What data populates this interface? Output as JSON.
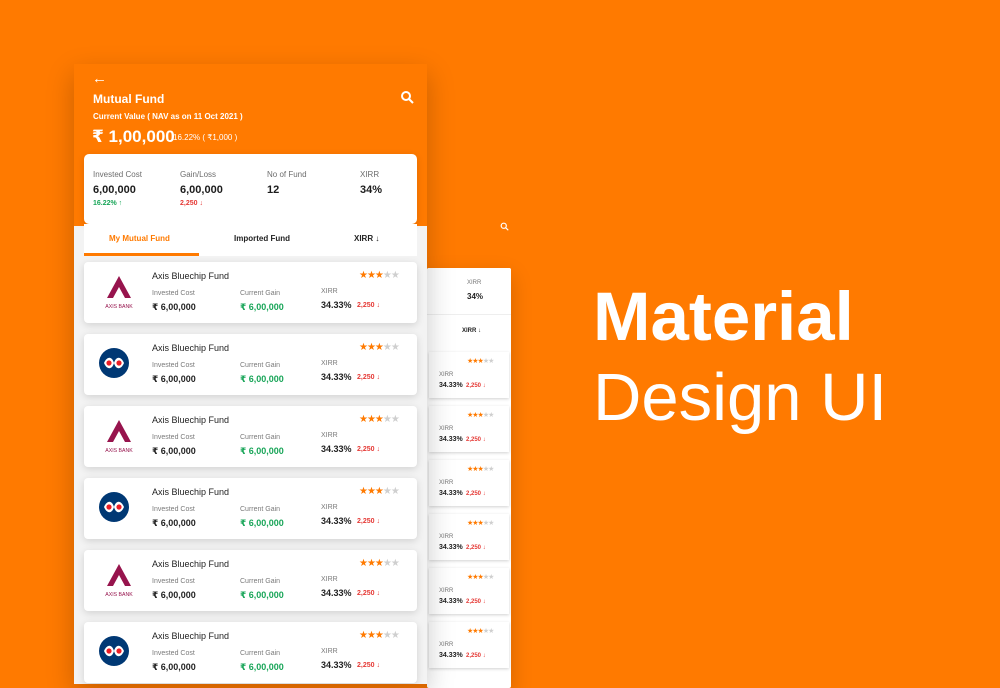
{
  "app": {
    "title": "Mutual Fund",
    "back_icon": "arrow-left-icon",
    "search_icon": "search-icon",
    "subtitle": "Current Value ( NAV as on 11 Oct 2021 )",
    "current_value": "₹ 1,00,000",
    "current_change": "16.22% ( ₹1,000 )"
  },
  "summary": {
    "invested_cost_label": "Invested Cost",
    "invested_cost_value": "6,00,000",
    "invested_change": "16.22% ↑",
    "gain_loss_label": "Gain/Loss",
    "gain_loss_value": "6,00,000",
    "gain_loss_change": "2,250 ↓",
    "no_of_fund_label": "No of Fund",
    "no_of_fund_value": "12",
    "xirr_label": "XIRR",
    "xirr_value": "34%"
  },
  "tabs": {
    "my_mutual_fund": "My Mutual Fund",
    "imported_fund": "Imported Fund",
    "xirr": "XIRR ↓"
  },
  "funds": [
    {
      "name": "Axis Bluechip Fund",
      "logo": "axis-bank-logo",
      "invested_cost_label": "Invested Cost",
      "invested_cost": "₹ 6,00,000",
      "current_gain_label": "Current Gain",
      "current_gain": "₹ 6,00,000",
      "xirr_label": "XIRR",
      "xirr": "34.33%",
      "loss": "2,250 ↓",
      "stars": "★★★"
    },
    {
      "name": "Axis Bluechip Fund",
      "logo": "kotak-logo",
      "invested_cost_label": "Invested Cost",
      "invested_cost": "₹ 6,00,000",
      "current_gain_label": "Current Gain",
      "current_gain": "₹ 6,00,000",
      "xirr_label": "XIRR",
      "xirr": "34.33%",
      "loss": "2,250 ↓",
      "stars": "★★★"
    },
    {
      "name": "Axis Bluechip Fund",
      "logo": "axis-bank-logo",
      "invested_cost_label": "Invested Cost",
      "invested_cost": "₹ 6,00,000",
      "current_gain_label": "Current Gain",
      "current_gain": "₹ 6,00,000",
      "xirr_label": "XIRR",
      "xirr": "34.33%",
      "loss": "2,250 ↓",
      "stars": "★★★"
    },
    {
      "name": "Axis Bluechip Fund",
      "logo": "kotak-logo",
      "invested_cost_label": "Invested Cost",
      "invested_cost": "₹ 6,00,000",
      "current_gain_label": "Current Gain",
      "current_gain": "₹ 6,00,000",
      "xirr_label": "XIRR",
      "xirr": "34.33%",
      "loss": "2,250 ↓",
      "stars": "★★★"
    },
    {
      "name": "Axis Bluechip Fund",
      "logo": "axis-bank-logo",
      "invested_cost_label": "Invested Cost",
      "invested_cost": "₹ 6,00,000",
      "current_gain_label": "Current Gain",
      "current_gain": "₹ 6,00,000",
      "xirr_label": "XIRR",
      "xirr": "34.33%",
      "loss": "2,250 ↓",
      "stars": "★★★"
    },
    {
      "name": "Axis Bluechip Fund",
      "logo": "kotak-logo",
      "invested_cost_label": "Invested Cost",
      "invested_cost": "₹ 6,00,000",
      "current_gain_label": "Current Gain",
      "current_gain": "₹ 6,00,000",
      "xirr_label": "XIRR",
      "xirr": "34.33%",
      "loss": "2,250 ↓",
      "stars": "★★★"
    }
  ],
  "ghost_screen": {
    "xirr_label": "XIRR",
    "xirr_value": "34%",
    "tab_xirr": "XIRR ↓",
    "rows": [
      {
        "xirr_label": "XIRR",
        "xirr": "34.33%",
        "loss": "2,250 ↓",
        "stars": "★★★"
      },
      {
        "xirr_label": "XIRR",
        "xirr": "34.33%",
        "loss": "2,250 ↓",
        "stars": "★★★"
      },
      {
        "xirr_label": "XIRR",
        "xirr": "34.33%",
        "loss": "2,250 ↓",
        "stars": "★★★"
      },
      {
        "xirr_label": "XIRR",
        "xirr": "34.33%",
        "loss": "2,250 ↓",
        "stars": "★★★"
      },
      {
        "xirr_label": "XIRR",
        "xirr": "34.33%",
        "loss": "2,250 ↓",
        "stars": "★★★"
      },
      {
        "xirr_label": "XIRR",
        "xirr": "34.33%",
        "loss": "2,250 ↓",
        "stars": "★★★"
      }
    ]
  },
  "headline": "Material",
  "subheadline": "Design UI",
  "colors": {
    "brand_orange": "#ff7a00",
    "gain_green": "#18a558",
    "loss_red": "#e53935",
    "white": "#ffffff"
  }
}
